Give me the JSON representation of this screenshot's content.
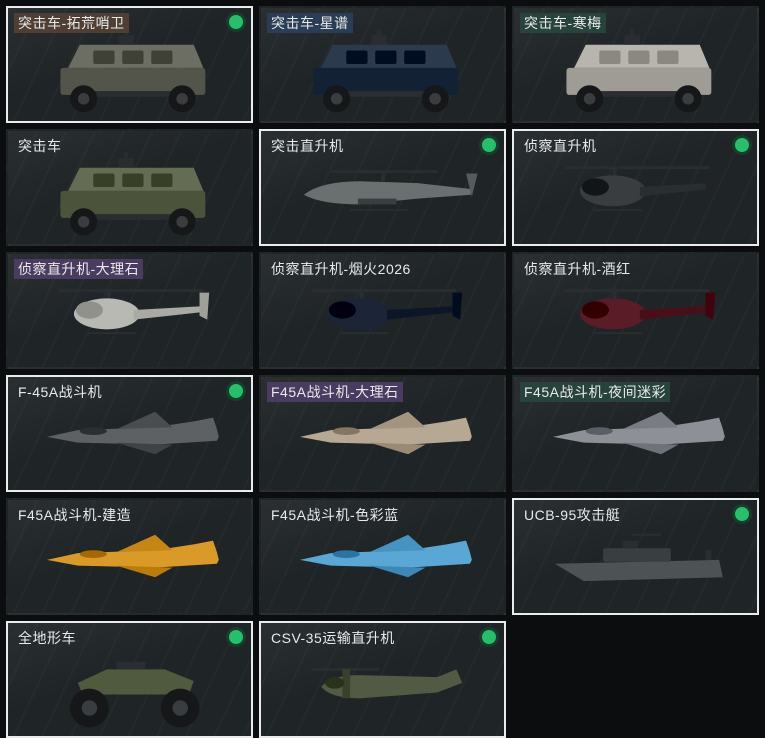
{
  "colors": {
    "badge": "#25c06b",
    "selected_border": "#e9ecee",
    "card_bg": "#1f2427"
  },
  "items": [
    {
      "label": "突击车-拓荒哨卫",
      "tag": "brown",
      "badge": true,
      "selected": true,
      "art": "armored-car",
      "paint": "#6d6e63"
    },
    {
      "label": "突击车-星谱",
      "tag": "blue",
      "badge": false,
      "selected": false,
      "art": "armored-car",
      "paint": "#2c3a4e"
    },
    {
      "label": "突击车-寒梅",
      "tag": "green",
      "badge": false,
      "selected": false,
      "art": "armored-car",
      "paint": "#b8b4ae"
    },
    {
      "label": "突击车",
      "tag": "none",
      "badge": false,
      "selected": false,
      "art": "armored-car",
      "paint": "#656c54"
    },
    {
      "label": "突击直升机",
      "tag": "none",
      "badge": true,
      "selected": true,
      "art": "attack-helicopter",
      "paint": "#6a6f70"
    },
    {
      "label": "侦察直升机",
      "tag": "none",
      "badge": true,
      "selected": true,
      "art": "scout-helicopter",
      "paint": "#3a3d40"
    },
    {
      "label": "侦察直升机-大理石",
      "tag": "purple",
      "badge": false,
      "selected": false,
      "art": "scout-helicopter",
      "paint": "#b9b9b4"
    },
    {
      "label": "侦察直升机-烟火2026",
      "tag": "none",
      "badge": false,
      "selected": false,
      "art": "scout-helicopter",
      "paint": "#1c2538"
    },
    {
      "label": "侦察直升机-酒红",
      "tag": "none",
      "badge": false,
      "selected": false,
      "art": "scout-helicopter",
      "paint": "#5a1c26"
    },
    {
      "label": "F-45A战斗机",
      "tag": "none",
      "badge": true,
      "selected": true,
      "art": "fighter-jet",
      "paint": "#5d6163"
    },
    {
      "label": "F45A战斗机-大理石",
      "tag": "purple",
      "badge": false,
      "selected": false,
      "art": "fighter-jet",
      "paint": "#b7a894"
    },
    {
      "label": "F45A战斗机-夜间迷彩",
      "tag": "green",
      "badge": false,
      "selected": false,
      "art": "fighter-jet",
      "paint": "#8d9197"
    },
    {
      "label": "F45A战斗机-建造",
      "tag": "none",
      "badge": false,
      "selected": false,
      "art": "fighter-jet",
      "paint": "#d99a27"
    },
    {
      "label": "F45A战斗机-色彩蓝",
      "tag": "none",
      "badge": false,
      "selected": false,
      "art": "fighter-jet",
      "paint": "#5aa7d6"
    },
    {
      "label": "UCB-95攻击艇",
      "tag": "none",
      "badge": true,
      "selected": true,
      "art": "attack-boat",
      "paint": "#4d5254"
    },
    {
      "label": "全地形车",
      "tag": "none",
      "badge": true,
      "selected": true,
      "art": "atv",
      "paint": "#4f5a3e"
    },
    {
      "label": "CSV-35运输直升机",
      "tag": "none",
      "badge": true,
      "selected": true,
      "art": "transport-tiltrotor",
      "paint": "#535a44"
    }
  ]
}
